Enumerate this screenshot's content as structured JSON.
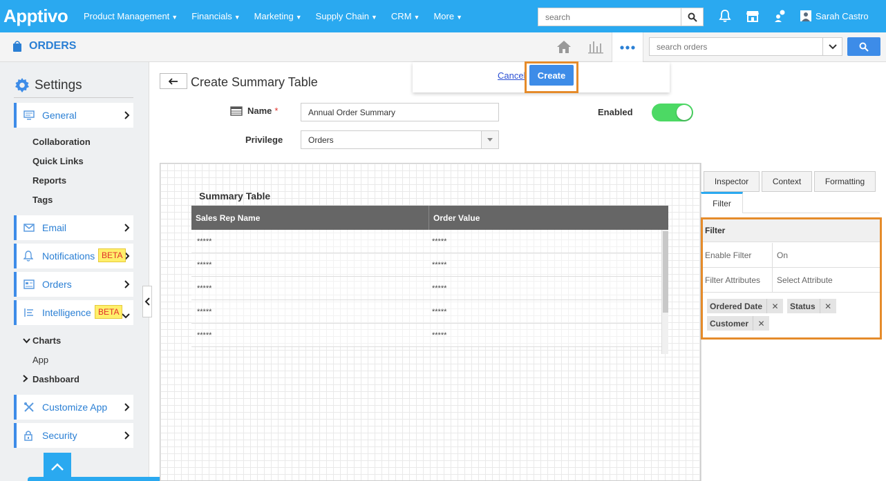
{
  "topnav": {
    "logo": "Apptivo",
    "items": [
      "Product Management",
      "Financials",
      "Marketing",
      "Supply Chain",
      "CRM",
      "More"
    ],
    "search_placeholder": "search",
    "user_name": "Sarah Castro"
  },
  "appbar": {
    "title": "ORDERS",
    "search_placeholder": "search orders"
  },
  "sidebar": {
    "heading": "Settings",
    "general": "General",
    "sub_items": [
      "Collaboration",
      "Quick Links",
      "Reports",
      "Tags"
    ],
    "email": "Email",
    "notifications": "Notifications",
    "orders": "Orders",
    "intelligence": "Intelligence",
    "beta": "BETA",
    "charts": "Charts",
    "app": "App",
    "dashboard": "Dashboard",
    "customize_app": "Customize App",
    "security": "Security"
  },
  "main": {
    "page_title": "Create Summary Table",
    "cancel": "Cancel",
    "create": "Create",
    "name_label": "Name",
    "name_required": "*",
    "name_value": "Annual Order Summary",
    "enabled_label": "Enabled",
    "privilege_label": "Privilege",
    "privilege_value": "Orders"
  },
  "summary_table": {
    "title": "Summary Table",
    "columns": [
      "Sales Rep Name",
      "Order Value"
    ],
    "rows": [
      [
        "*****",
        "*****"
      ],
      [
        "*****",
        "*****"
      ],
      [
        "*****",
        "*****"
      ],
      [
        "*****",
        "*****"
      ],
      [
        "*****",
        "*****"
      ]
    ]
  },
  "inspector": {
    "tabs": [
      "Inspector",
      "Context",
      "Formatting"
    ],
    "subtab": "Filter",
    "section_title": "Filter",
    "enable_filter_label": "Enable Filter",
    "enable_filter_value": "On",
    "filter_attributes_label": "Filter Attributes",
    "filter_attributes_placeholder": "Select Attribute",
    "chips": [
      "Ordered Date",
      "Status",
      "Customer"
    ]
  }
}
